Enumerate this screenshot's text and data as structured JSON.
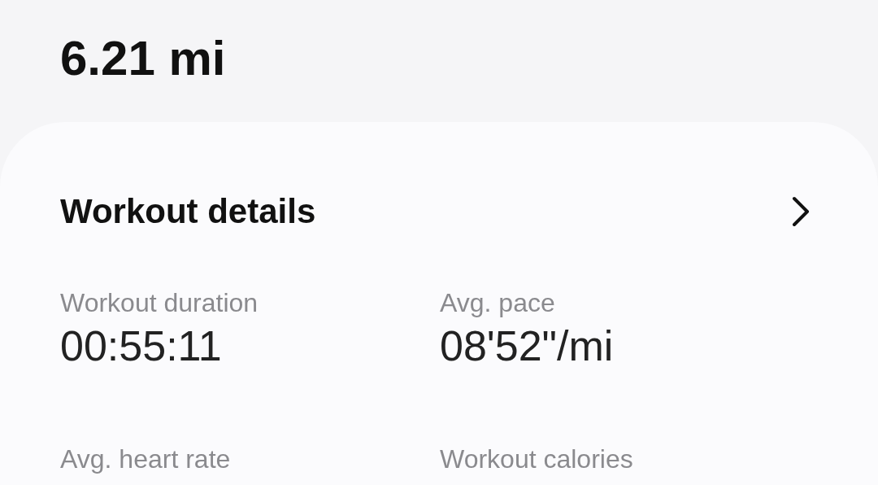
{
  "distance": "6.21 mi",
  "card": {
    "title": "Workout details",
    "stats": [
      {
        "label": "Workout duration",
        "value": "00:55:11"
      },
      {
        "label": "Avg. pace",
        "value": "08'52\"/mi"
      },
      {
        "label": "Avg. heart rate"
      },
      {
        "label": "Workout calories"
      }
    ]
  }
}
